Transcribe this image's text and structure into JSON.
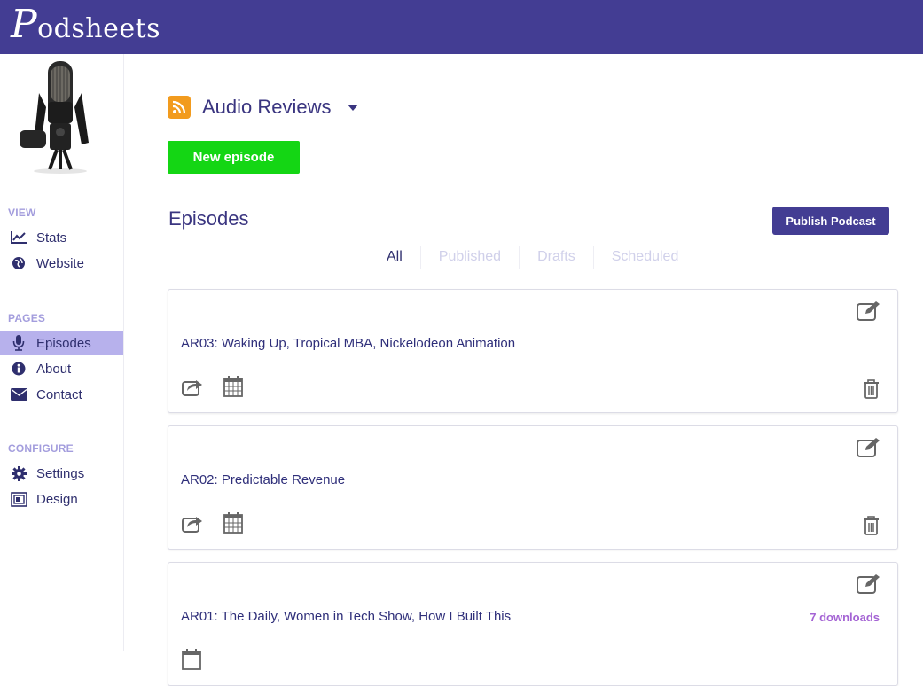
{
  "app": {
    "logo_initial": "P",
    "logo_rest": "odsheets"
  },
  "sidebar": {
    "sections": [
      {
        "label": "VIEW"
      },
      {
        "label": "PAGES"
      },
      {
        "label": "CONFIGURE"
      }
    ],
    "items": [
      {
        "label": "Stats",
        "icon": "line-chart-icon"
      },
      {
        "label": "Website",
        "icon": "globe-icon"
      },
      {
        "label": "Episodes",
        "icon": "microphone-icon",
        "active": true
      },
      {
        "label": "About",
        "icon": "info-icon"
      },
      {
        "label": "Contact",
        "icon": "envelope-icon"
      },
      {
        "label": "Settings",
        "icon": "gear-icon"
      },
      {
        "label": "Design",
        "icon": "design-icon"
      }
    ]
  },
  "main": {
    "podcast_title": "Audio Reviews",
    "new_episode_label": "New episode",
    "episodes_heading": "Episodes",
    "publish_label": "Publish Podcast",
    "filters": [
      "All",
      "Published",
      "Drafts",
      "Scheduled"
    ],
    "episodes": [
      {
        "title": "AR03: Waking Up, Tropical MBA, Nickelodeon Animation"
      },
      {
        "title": "AR02: Predictable Revenue"
      },
      {
        "title": "AR01: The Daily, Women in Tech Show, How I Built This",
        "downloads": "7 downloads"
      }
    ]
  },
  "colors": {
    "brand": "#433d93",
    "new_button": "#14d614",
    "rss": "#f29b1e",
    "active_nav": "#b7b1ec",
    "downloads": "#a463d4"
  }
}
